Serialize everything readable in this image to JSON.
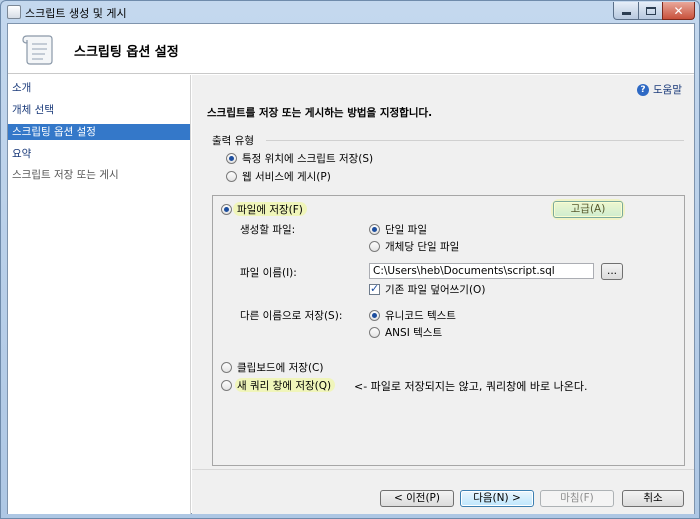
{
  "window": {
    "title": "스크립트 생성 및 게시",
    "icon": "script-wizard-icon"
  },
  "header": {
    "title": "스크립팅 옵션 설정",
    "icon": "scroll-icon"
  },
  "nav": {
    "items": [
      {
        "label": "소개",
        "state": "link"
      },
      {
        "label": "개체 선택",
        "state": "link"
      },
      {
        "label": "스크립팅 옵션 설정",
        "state": "active"
      },
      {
        "label": "요약",
        "state": "link"
      },
      {
        "label": "스크립트 저장 또는 게시",
        "state": "plain"
      }
    ]
  },
  "main": {
    "help_label": "도움말",
    "instruction": "스크립트를 저장 또는 게시하는 방법을 지정합니다.",
    "output_type": {
      "label": "출력 유형",
      "options": [
        {
          "label": "특정 위치에 스크립트 저장(S)",
          "selected": true
        },
        {
          "label": "웹 서비스에 게시(P)",
          "selected": false
        }
      ]
    },
    "save_to_file": {
      "label": "파일에 저장(F)",
      "selected": true,
      "advanced_button": "고급(A)",
      "files_to_generate": {
        "label": "생성할 파일:",
        "options": [
          {
            "label": "단일 파일",
            "selected": true
          },
          {
            "label": "개체당 단일 파일",
            "selected": false
          }
        ]
      },
      "file_name": {
        "label": "파일 이름(I):",
        "value": "C:\\Users\\heb\\Documents\\script.sql",
        "browse_button": "...",
        "overwrite": {
          "label": "기존 파일 덮어쓰기(O)",
          "checked": true
        }
      },
      "save_as": {
        "label": "다른 이름으로 저장(S):",
        "options": [
          {
            "label": "유니코드 텍스트",
            "selected": true
          },
          {
            "label": "ANSI 텍스트",
            "selected": false
          }
        ]
      }
    },
    "clipboard": {
      "label": "클립보드에 저장(C)",
      "selected": false
    },
    "new_query": {
      "label": "새 쿼리 창에 저장(Q)",
      "selected": false
    },
    "annotation": "<- 파일로 저장되지는 않고, 쿼리창에 바로 나온다."
  },
  "footer": {
    "back": "< 이전(P)",
    "next": "다음(N) >",
    "finish": "마침(F)",
    "cancel": "취소"
  },
  "colors": {
    "nav_active": "#3478c9",
    "highlighter": "#f0fa78"
  }
}
